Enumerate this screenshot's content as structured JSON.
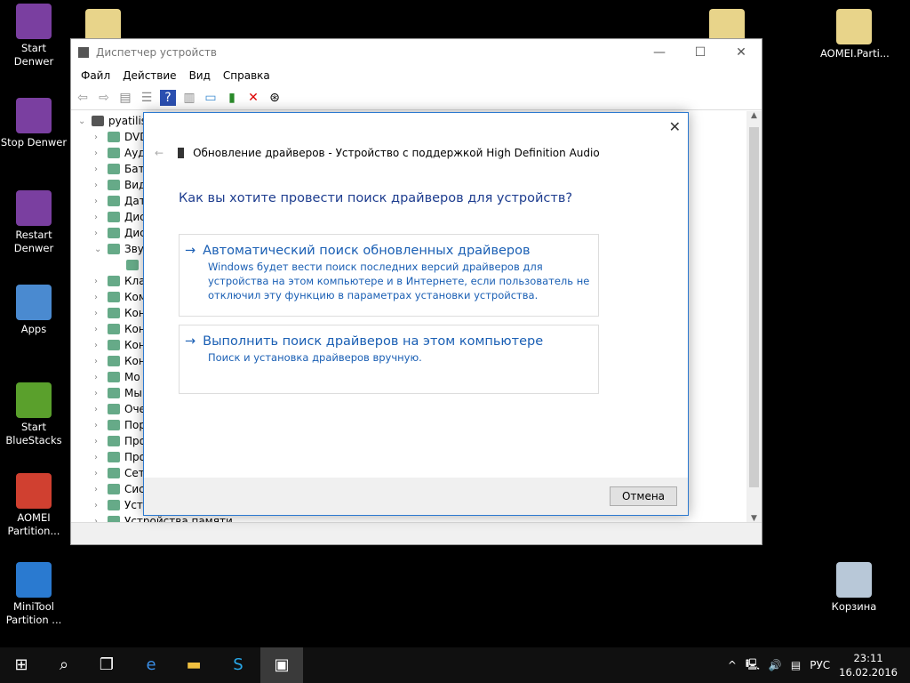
{
  "desktop": {
    "icons": [
      {
        "label": "Start Denwer",
        "color": "#7a3fa0"
      },
      {
        "label": "Stop Denwer",
        "color": "#7a3fa0"
      },
      {
        "label": "Restart Denwer",
        "color": "#7a3fa0"
      },
      {
        "label": "Apps",
        "color": "#4a8ad0"
      },
      {
        "label": "Start BlueStacks",
        "color": "#5aa02c"
      },
      {
        "label": "AOMEI Partition...",
        "color": "#d04030"
      },
      {
        "label": "MiniTool Partition ...",
        "color": "#2a7ad0"
      },
      {
        "label": "AOMEI.Parti...",
        "color": "#e8d48a"
      },
      {
        "label": "Корзина",
        "color": "#b8c8d8"
      }
    ]
  },
  "window": {
    "title": "Диспетчер устройств",
    "menu": [
      "Файл",
      "Действие",
      "Вид",
      "Справка"
    ],
    "tree": {
      "root": "pyatilis",
      "items": [
        {
          "label": "DVD",
          "expanded": false
        },
        {
          "label": "Ауд",
          "expanded": false
        },
        {
          "label": "Бат",
          "expanded": false
        },
        {
          "label": "Вид",
          "expanded": false
        },
        {
          "label": "Дат",
          "expanded": false
        },
        {
          "label": "Дис",
          "expanded": false
        },
        {
          "label": "Дис",
          "expanded": false
        },
        {
          "label": "Зву",
          "expanded": true
        },
        {
          "label": "",
          "child": true
        },
        {
          "label": "Кла"
        },
        {
          "label": "Ком"
        },
        {
          "label": "Кон"
        },
        {
          "label": "Кон"
        },
        {
          "label": "Кон"
        },
        {
          "label": "Кон"
        },
        {
          "label": "Мо"
        },
        {
          "label": "Мы"
        },
        {
          "label": "Оче"
        },
        {
          "label": "Пор"
        },
        {
          "label": "Про"
        },
        {
          "label": "Про"
        },
        {
          "label": "Сет"
        },
        {
          "label": "Сис"
        },
        {
          "label": "Уст"
        },
        {
          "label": "Устройства памяти"
        }
      ]
    }
  },
  "dialog": {
    "header": "Обновление драйверов - Устройство с поддержкой High Definition Audio",
    "question": "Как вы хотите провести поиск драйверов для устройств?",
    "options": [
      {
        "title": "Автоматический поиск обновленных драйверов",
        "desc": "Windows будет вести поиск последних версий драйверов для устройства на этом компьютере и в Интернете, если пользователь не отключил эту функцию в параметрах установки устройства."
      },
      {
        "title": "Выполнить поиск драйверов на этом компьютере",
        "desc": "Поиск и установка драйверов вручную."
      }
    ],
    "cancel": "Отмена"
  },
  "taskbar": {
    "lang": "РУС",
    "time": "23:11",
    "date": "16.02.2016"
  }
}
